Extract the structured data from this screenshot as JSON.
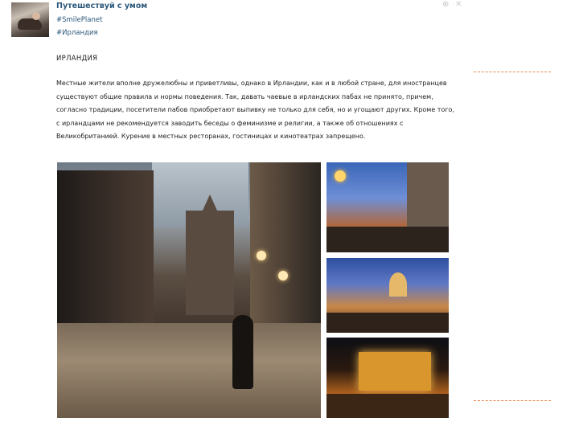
{
  "post": {
    "group_name": "Путешествуй с умом",
    "tags": [
      "#SmilePlanet",
      "#Ирландия"
    ],
    "title": "ИРЛАНДИЯ",
    "body": "Местные жители вполне дружелюбны и приветливы, однако в Ирландии, как и в любой стране, для иностранцев существуют общие правила и нормы поведения. Так, давать чаевые в ирландских пабах не принято, причем, согласно традиции, посетители пабов приобретают выпивку не только для себя, но и угощают других. Кроме того, с ирландцами не рекомендуется заводить беседы о феминизме и религии, а также об отношениях с Великобританией. Курение в местных ресторанах, гостиницах и кинотеатрах запрещено."
  },
  "controls": {
    "options_glyph": "⊗",
    "close_glyph": "✕"
  },
  "photos": [
    {
      "name": "dublin-street-church"
    },
    {
      "name": "canal-evening"
    },
    {
      "name": "city-dome-evening"
    },
    {
      "name": "pub-night"
    }
  ],
  "icons": {
    "avatar": "group-avatar-photo",
    "close": "close-icon",
    "options": "options-icon"
  },
  "colors": {
    "link": "#2b587a",
    "text": "#222222",
    "accent_dashed": "#e98a4f",
    "icon_muted": "#c9c9c9"
  }
}
